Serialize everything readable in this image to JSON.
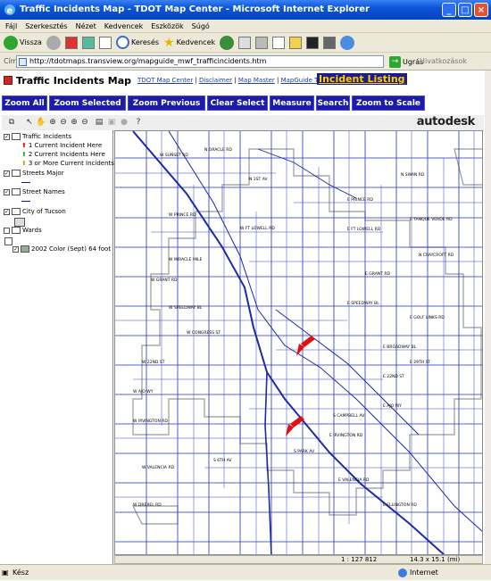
{
  "window": {
    "title": "Traffic Incidents Map - TDOT Map Center - Microsoft Internet Explorer"
  },
  "menu": [
    "Fájl",
    "Szerkesztés",
    "Nézet",
    "Kedvencek",
    "Eszközök",
    "Súgó"
  ],
  "toolbar": {
    "back": "Vissza",
    "search": "Keresés",
    "favorites": "Kedvencek"
  },
  "address": {
    "label": "Cím",
    "url": "http://tdotmaps.transview.org/mapguide_mwf_trafficincidents.htm",
    "go": "Ugrás",
    "links": "Hivatkozások"
  },
  "app": {
    "title": "Traffic Incidents Map",
    "links": [
      "TDOT Map Center",
      "Disclaimer",
      "Map Master",
      "MapGuide Tips & Help"
    ],
    "incident_listing": "Incident Listing",
    "buttons": [
      "Zoom All",
      "Zoom Selected",
      "Zoom Previous",
      "Clear Select",
      "Measure",
      "Search",
      "Zoom to Scale"
    ],
    "brand": "autodesk"
  },
  "legend": {
    "traffic": "Traffic Incidents",
    "one": "1 Current Incident Here",
    "two": "2 Current Incidents Here",
    "three": "3 or More Current Incidents Here",
    "streets_major": "Streets Major",
    "street_names": "Street Names",
    "city": "City of Tucson",
    "wards": "Wards",
    "aerial": "2002 Color (Sept) 64 foot"
  },
  "map": {
    "scale": "1 : 127 812",
    "size": "14.3 x 15.1 (mi)",
    "labels": [
      "W SUNSET RD",
      "N ORACLE RD",
      "N 1ST AV",
      "E PRINCE RD",
      "W PRINCE RD",
      "E FT LOWELL RD",
      "W FT LOWELL RD",
      "W MIRACLE MILE",
      "E GRANT RD",
      "W GRANT RD",
      "E SPEEDWAY BL",
      "W SPEEDWAY BL",
      "W CONGRESS ST",
      "E BROADWAY BL",
      "W 22ND ST",
      "E 22ND ST",
      "S CAMPBELL AV",
      "W AJO WY",
      "E AJO WY",
      "E IRVINGTON RD",
      "W IRVINGTON RD",
      "W VALENCIA RD",
      "E VALENCIA RD",
      "S 6TH AV",
      "N SWAN RD",
      "N CRAYCROFT RD",
      "E TANQUE VERDE RD",
      "E GOLF LINKS RD",
      "E 29TH ST",
      "W DREXEL RD",
      "S PARK AV",
      "E ELLINGTON RD"
    ]
  },
  "status": {
    "left": "Kész",
    "zone": "Internet"
  }
}
